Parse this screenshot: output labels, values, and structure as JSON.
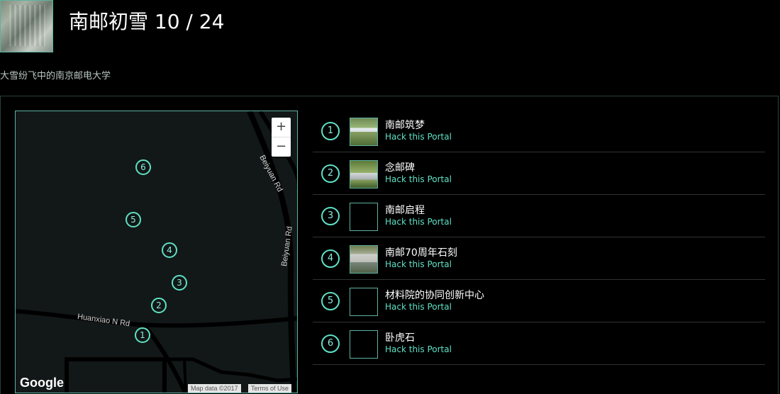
{
  "header": {
    "title": "南邮初雪 10 / 24",
    "subtitle": "大雪纷飞中的南京邮电大学"
  },
  "map": {
    "zoom_in": "+",
    "zoom_out": "−",
    "roads": [
      "Beiyuan Rd",
      "Beiyuan Rd",
      "Huanxiao N Rd"
    ],
    "google": "Google",
    "map_data": "Map data ©2017",
    "terms": "Terms of Use",
    "markers": [
      "1",
      "2",
      "3",
      "4",
      "5",
      "6"
    ]
  },
  "portals": [
    {
      "num": "1",
      "name": "南邮筑梦",
      "link": "Hack this Portal",
      "thumb": "photo"
    },
    {
      "num": "2",
      "name": "念邮碑",
      "link": "Hack this Portal",
      "thumb": "photo"
    },
    {
      "num": "3",
      "name": "南邮启程",
      "link": "Hack this Portal",
      "thumb": "empty"
    },
    {
      "num": "4",
      "name": "南邮70周年石刻",
      "link": "Hack this Portal",
      "thumb": "photo"
    },
    {
      "num": "5",
      "name": "材料院的协同创新中心",
      "link": "Hack this Portal",
      "thumb": "empty"
    },
    {
      "num": "6",
      "name": "卧虎石",
      "link": "Hack this Portal",
      "thumb": "empty"
    }
  ],
  "colors": {
    "accent": "#5fe0c6",
    "background": "#000000",
    "map_bg": "#121817"
  }
}
